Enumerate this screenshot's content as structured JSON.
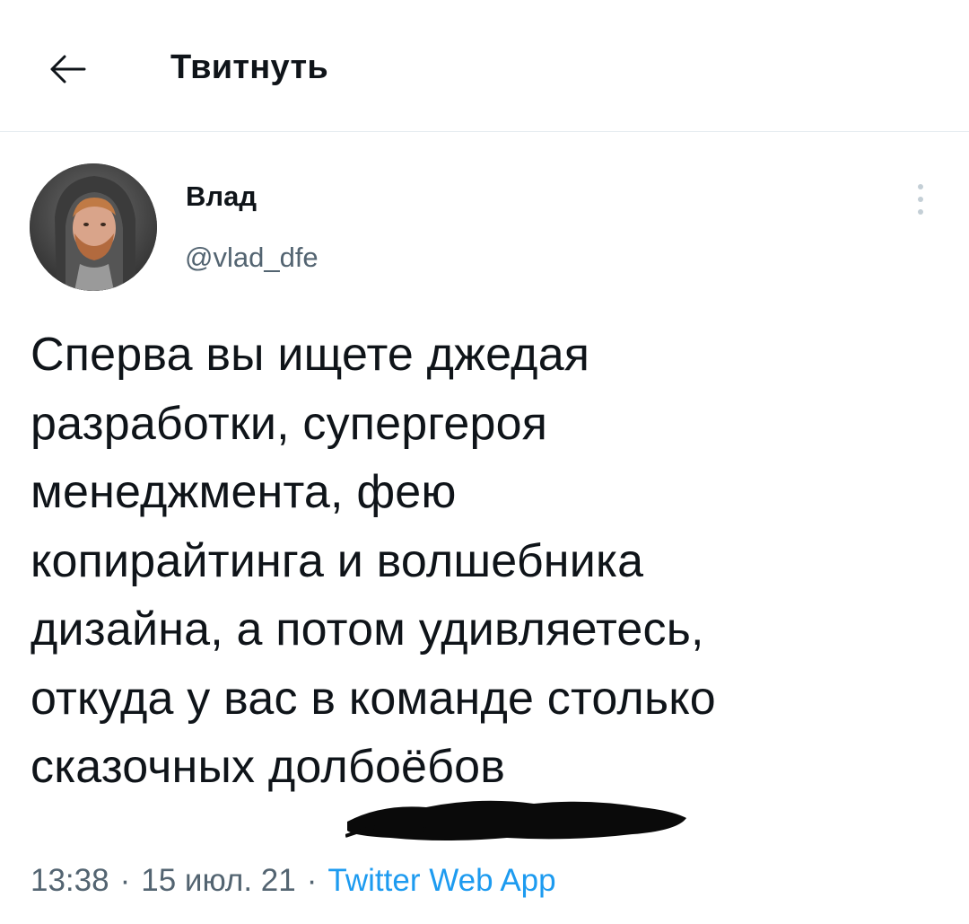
{
  "header": {
    "title": "Твитнуть",
    "back_icon": "arrow-left-icon"
  },
  "tweet": {
    "author": {
      "display_name": "Влад",
      "handle": "@vlad_dfe",
      "avatar_icon": "user-avatar"
    },
    "more_icon": "vertical-ellipsis-icon",
    "text_lines": [
      "Сперва вы ищете джедая",
      "разработки, супергероя",
      "менеджмента, фею",
      "копирайтинга и волшебника",
      "дизайна, а потом удивляетесь,",
      "откуда у вас в команде столько",
      "сказочных долбоёбов"
    ],
    "meta": {
      "time": "13:38",
      "separator": "·",
      "date": "15 июл. 21",
      "source": "Twitter Web App"
    }
  },
  "colors": {
    "text": "#0f1419",
    "secondary": "#536471",
    "link": "#1d9bf0",
    "divider": "#e6ecf0"
  }
}
